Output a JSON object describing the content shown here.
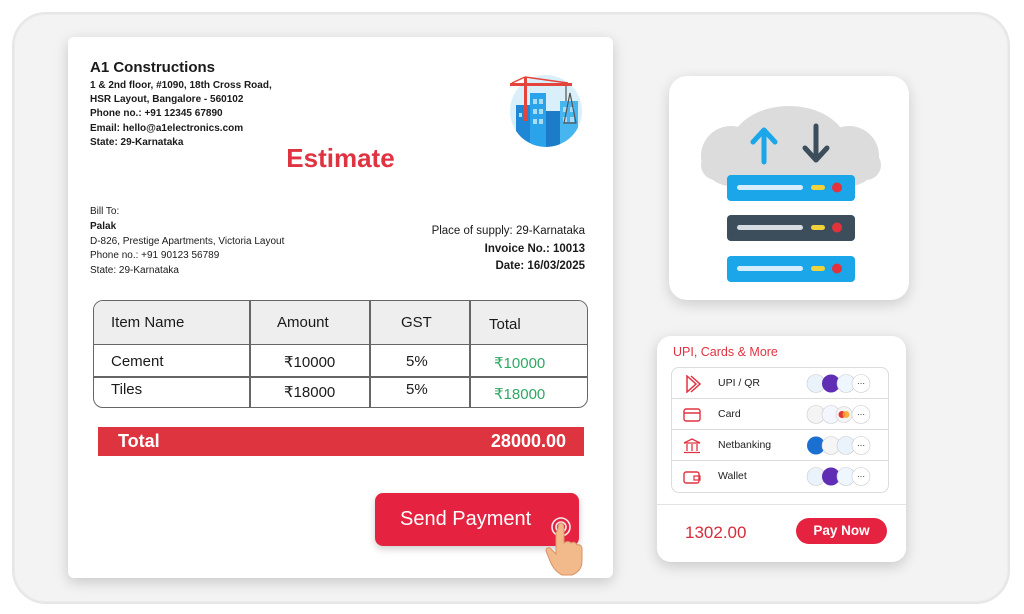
{
  "invoice": {
    "company": {
      "name": "A1 Constructions",
      "address1": "1 & 2nd floor, #1090, 18th Cross Road,",
      "address2": "HSR Layout, Bangalore - 560102",
      "phone": "Phone no.: +91 12345 67890",
      "email": "Email: hello@a1electronics.com",
      "state": "State: 29-Karnataka"
    },
    "title": "Estimate",
    "bill_to": {
      "label": "Bill To:",
      "name": "Palak",
      "address": "D-826, Prestige Apartments, Victoria Layout",
      "phone": "Phone no.: +91 90123 56789",
      "state": "State: 29-Karnataka"
    },
    "meta": {
      "place_of_supply": "Place of supply: 29-Karnataka",
      "invoice_no": "Invoice No.: 10013",
      "date": "Date: 16/03/2025"
    },
    "table": {
      "headers": [
        "Item Name",
        "Amount",
        "GST",
        "Total"
      ],
      "rows": [
        [
          "Cement",
          "₹10000",
          "5%",
          "₹10000"
        ],
        [
          "Tiles",
          "₹18000",
          "5%",
          "₹18000"
        ]
      ]
    },
    "total_label": "Total",
    "total_amount": "28000.00",
    "send_payment_label": "Send Payment"
  },
  "payment": {
    "title": "UPI, Cards & More",
    "methods": [
      {
        "label": "UPI / QR",
        "icon": "upi-icon"
      },
      {
        "label": "Card",
        "icon": "card-icon"
      },
      {
        "label": "Netbanking",
        "icon": "bank-icon"
      },
      {
        "label": "Wallet",
        "icon": "wallet-icon"
      }
    ],
    "amount": "1302.00",
    "pay_now_label": "Pay Now"
  },
  "colors": {
    "accent_red": "#e52340",
    "total_red": "#de3440",
    "green": "#2fa864",
    "server_blue": "#1aa6e8",
    "server_dark": "#3c4d5c"
  }
}
